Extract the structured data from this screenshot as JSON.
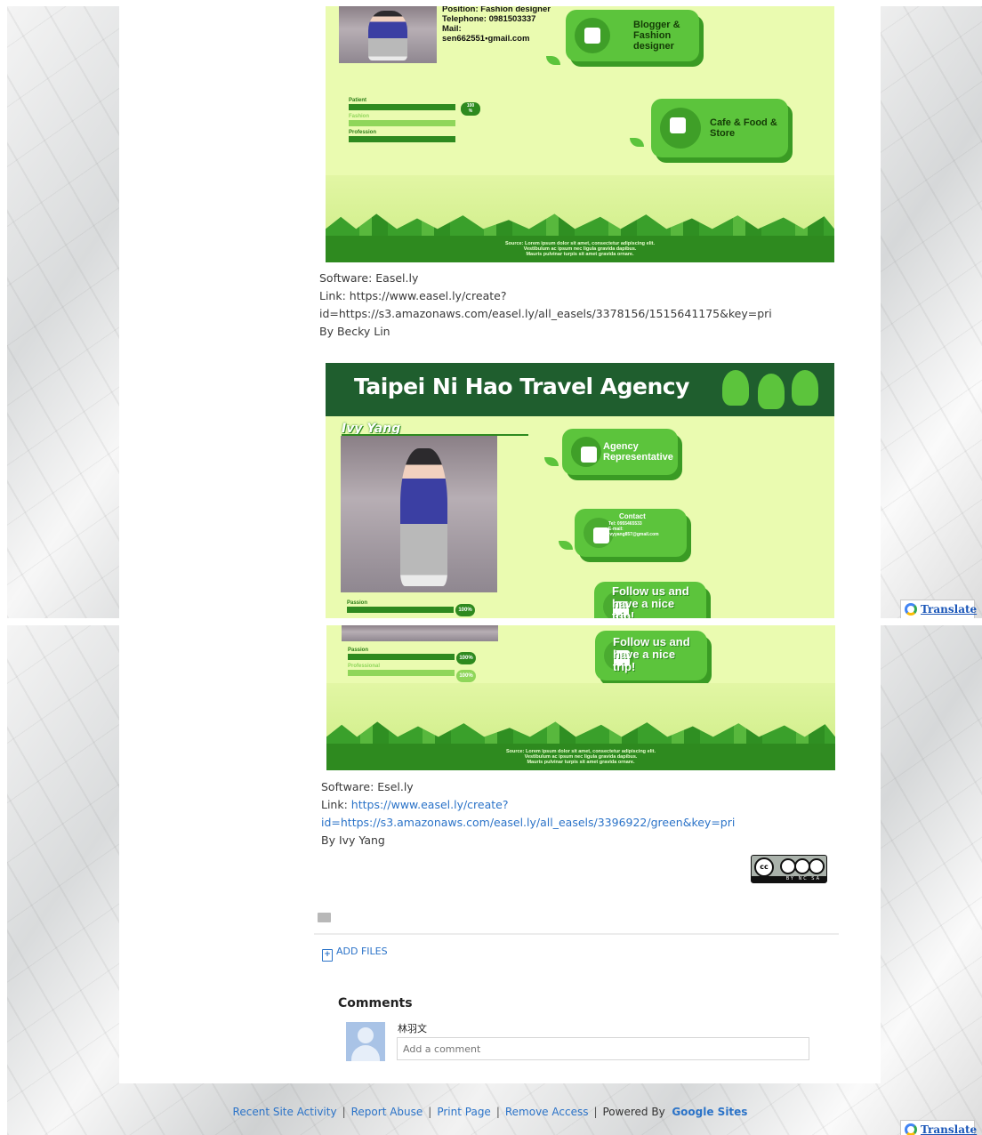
{
  "top": {
    "poster1": {
      "profile_text": "Position: Fashion designer\nTelephone: 0981503337\nMail:\nsen662551▪gmail.com",
      "bubble_blogger": "Blogger &\nFashion\ndesigner",
      "bubble_cafe": "Cafe & Food &\nStore",
      "skills": [
        "Patient",
        "Fashion",
        "Profession"
      ],
      "skill_badge": "100\n%",
      "footnote": "Source: Lorem ipsum dolor sit amet, consectetur adipiscing elit.\nVestibulum ac ipsum nec ligula gravida dapibus.\nMauris pulvinar turpis sit amet gravida ornare."
    },
    "caption1": {
      "software": "Software: Easel.ly",
      "link_line1": "Link: https://www.easel.ly/create?",
      "link_line2": "id=https://s3.amazonaws.com/easel.ly/all_easels/3378156/1515641175&key=pri",
      "author": "By Becky Lin"
    },
    "poster2": {
      "title": "Taipei Ni Hao Travel Agency",
      "name": "Ivy Yang",
      "bubble_agency": "Agency\nRepresentative",
      "bubble_contact_title": "Contact",
      "bubble_contact_text": "Tel: 0955465533\nE-mail:\nivyyang857@gmail.com",
      "bubble_follow": "Follow us and\nhave a nice\ntrip!",
      "skill_passion": "Passion",
      "skill_badge": "100%"
    },
    "translate_label": "Translate"
  },
  "bottom": {
    "poster2": {
      "skills": [
        "Passion",
        "Professional"
      ],
      "skill_badge": "100%",
      "bubble_follow": "Follow us and\nhave a nice\ntrip!",
      "footnote": "Source: Lorem ipsum dolor sit amet, consectetur adipiscing elit.\nVestibulum ac ipsum nec ligula gravida dapibus.\nMauris pulvinar turpis sit amet gravida ornare."
    },
    "caption2": {
      "software": "Software: Esel.ly",
      "link_prefix": "Link: ",
      "link_line1": "https://www.easel.ly/create?",
      "link_line2": "id=https://s3.amazonaws.com/easel.ly/all_easels/3396922/green&key=pri",
      "author": "By Ivy Yang"
    },
    "license_badge": {
      "cc": "cc",
      "marks": "BY  NC  SA"
    },
    "add_files": "ADD FILES",
    "comments": {
      "heading": "Comments",
      "user": "林羽文",
      "placeholder": "Add a comment"
    },
    "footer": {
      "recent": "Recent Site Activity",
      "report": "Report Abuse",
      "print": "Print Page",
      "remove": "Remove Access",
      "powered": "Powered By",
      "google_sites": "Google Sites"
    },
    "translate_label": "Translate"
  },
  "colors": {
    "link": "#2b73c8",
    "poster_green": "#2e8a1f",
    "bubble_green": "#5cc43c",
    "poster_bg": "#eafbb0"
  }
}
